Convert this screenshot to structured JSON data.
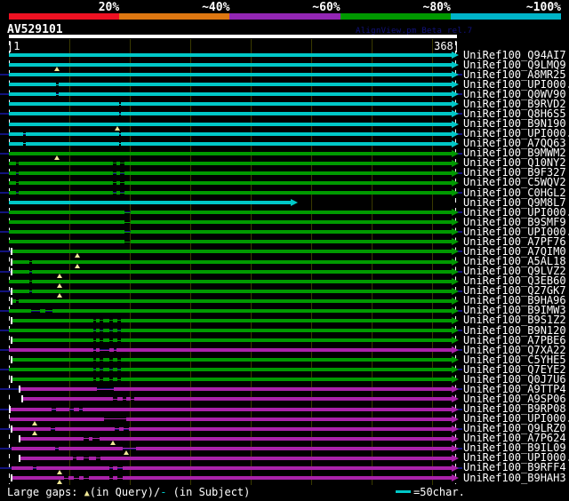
{
  "header": {
    "title": "AV529101",
    "watermark": "AlignView.pm Beta rel.7"
  },
  "scale": {
    "labels": [
      "20%",
      "~40%",
      "~60%",
      "~80%",
      "~100%"
    ],
    "colors": [
      "#EE1122",
      "#DD7711",
      "#9326B4",
      "#009900",
      "#00B4C8"
    ]
  },
  "ruler": {
    "start_label": "|1",
    "end_label": "368|",
    "length": 368
  },
  "legend": {
    "prefix": "Large gaps: ",
    "triangle": "▲",
    "mid": "(in Query)/",
    "dash": "-",
    "suffix": " (in Subject)",
    "scale_note": "=50char."
  },
  "colors": {
    "cyan": "#00C8C8",
    "green": "#009900",
    "magenta": "#AA22AA",
    "navy": "#12127E",
    "grid": "#3A3A00",
    "triangle": "#F0E896",
    "white": "#FFFFFF"
  },
  "rows": [
    {
      "label": "UniRef100_Q94AI7",
      "color": "cyan",
      "segments": [
        [
          0,
          368
        ]
      ],
      "triangles": [],
      "tick": false,
      "leader": false,
      "end": 368
    },
    {
      "label": "UniRef100_Q9LMQ9",
      "color": "cyan",
      "segments": [
        [
          0,
          368
        ]
      ],
      "triangles": [
        40
      ],
      "tick": false,
      "leader": false,
      "end": 368
    },
    {
      "label": "UniRef100_A8MR25",
      "color": "cyan",
      "segments": [
        [
          0,
          368
        ]
      ],
      "triangles": [],
      "tick": false,
      "leader": true,
      "end": 368
    },
    {
      "label": "UniRef100_UPI000..",
      "color": "cyan",
      "segments": [
        [
          0,
          39
        ],
        [
          41,
          368
        ]
      ],
      "triangles": [],
      "tick": false,
      "leader": false,
      "end": 368
    },
    {
      "label": "UniRef100_Q0WV90",
      "color": "cyan",
      "segments": [
        [
          0,
          39
        ],
        [
          41,
          368
        ]
      ],
      "triangles": [],
      "tick": false,
      "leader": true,
      "end": 368
    },
    {
      "label": "UniRef100_B9RVD2",
      "color": "cyan",
      "segments": [
        [
          0,
          91
        ],
        [
          93,
          368
        ]
      ],
      "triangles": [],
      "tick": false,
      "leader": false,
      "end": 368
    },
    {
      "label": "UniRef100_Q8H6S5",
      "color": "cyan",
      "segments": [
        [
          0,
          91
        ],
        [
          93,
          368
        ]
      ],
      "triangles": [],
      "tick": false,
      "leader": true,
      "end": 368
    },
    {
      "label": "UniRef100_B9N190",
      "color": "cyan",
      "segments": [
        [
          0,
          368
        ]
      ],
      "triangles": [
        90
      ],
      "tick": false,
      "leader": false,
      "end": 368
    },
    {
      "label": "UniRef100_UPI000..",
      "color": "cyan",
      "segments": [
        [
          0,
          12
        ],
        [
          14,
          91
        ],
        [
          93,
          368
        ]
      ],
      "triangles": [],
      "tick": false,
      "leader": true,
      "end": 368
    },
    {
      "label": "UniRef100_A7QQ63",
      "color": "cyan",
      "segments": [
        [
          0,
          12
        ],
        [
          14,
          91
        ],
        [
          93,
          368
        ]
      ],
      "triangles": [],
      "tick": false,
      "leader": false,
      "end": 368
    },
    {
      "label": "UniRef100_B9MWM2",
      "color": "green",
      "segments": [
        [
          0,
          368
        ]
      ],
      "triangles": [
        40
      ],
      "tick": false,
      "leader": true,
      "end": 368
    },
    {
      "label": "UniRef100_Q10NY2",
      "color": "green",
      "segments": [
        [
          0,
          6
        ],
        [
          8,
          86
        ],
        [
          89,
          92
        ],
        [
          96,
          368
        ]
      ],
      "triangles": [],
      "tick": false,
      "leader": false,
      "end": 368
    },
    {
      "label": "UniRef100_B9F327",
      "color": "green",
      "segments": [
        [
          0,
          6
        ],
        [
          8,
          86
        ],
        [
          89,
          92
        ],
        [
          96,
          368
        ]
      ],
      "triangles": [],
      "tick": false,
      "leader": true,
      "end": 368
    },
    {
      "label": "UniRef100_C5WQV2",
      "color": "green",
      "segments": [
        [
          0,
          6
        ],
        [
          8,
          86
        ],
        [
          89,
          92
        ],
        [
          96,
          368
        ]
      ],
      "triangles": [],
      "tick": false,
      "leader": false,
      "end": 368
    },
    {
      "label": "UniRef100_C0HGL2",
      "color": "green",
      "segments": [
        [
          0,
          6
        ],
        [
          8,
          86
        ],
        [
          89,
          92
        ],
        [
          96,
          368
        ]
      ],
      "triangles": [],
      "tick": false,
      "leader": true,
      "end": 368
    },
    {
      "label": "UniRef100_Q9M8L7",
      "color": "cyan",
      "segments": [
        [
          0,
          235
        ]
      ],
      "triangles": [],
      "tick": false,
      "leader": false,
      "end": 235
    },
    {
      "label": "UniRef100_UPI000..",
      "color": "green",
      "segments": [
        [
          0,
          96
        ],
        [
          101,
          368
        ]
      ],
      "triangles": [],
      "tick": false,
      "leader": true,
      "end": 368
    },
    {
      "label": "UniRef100_B9SMF9",
      "color": "green",
      "segments": [
        [
          0,
          96
        ],
        [
          101,
          368
        ]
      ],
      "triangles": [],
      "tick": false,
      "leader": false,
      "end": 368
    },
    {
      "label": "UniRef100_UPI000..",
      "color": "green",
      "segments": [
        [
          0,
          96
        ],
        [
          101,
          368
        ]
      ],
      "triangles": [],
      "tick": false,
      "leader": true,
      "end": 368
    },
    {
      "label": "UniRef100_A7PF76",
      "color": "green",
      "segments": [
        [
          0,
          96
        ],
        [
          101,
          368
        ]
      ],
      "triangles": [],
      "tick": false,
      "leader": false,
      "end": 368
    },
    {
      "label": "UniRef100_A7QIM0",
      "color": "green",
      "segments": [
        [
          2,
          368
        ]
      ],
      "triangles": [
        57
      ],
      "tick": true,
      "leader": true,
      "end": 368
    },
    {
      "label": "UniRef100_A5AL18",
      "color": "green",
      "segments": [
        [
          2,
          17
        ],
        [
          19,
          368
        ]
      ],
      "triangles": [
        57
      ],
      "tick": true,
      "leader": false,
      "end": 368
    },
    {
      "label": "UniRef100_Q9LVZ2",
      "color": "green",
      "segments": [
        [
          2,
          17
        ],
        [
          19,
          368
        ]
      ],
      "triangles": [
        42
      ],
      "tick": true,
      "leader": true,
      "end": 368
    },
    {
      "label": "UniRef100_Q3EB60",
      "color": "green",
      "segments": [
        [
          0,
          17
        ],
        [
          19,
          368
        ]
      ],
      "triangles": [
        42
      ],
      "tick": false,
      "leader": false,
      "end": 368
    },
    {
      "label": "UniRef100_Q27GK7",
      "color": "green",
      "segments": [
        [
          2,
          17
        ],
        [
          19,
          368
        ]
      ],
      "triangles": [
        42
      ],
      "tick": true,
      "leader": true,
      "end": 368
    },
    {
      "label": "UniRef100_B9HA96",
      "color": "green",
      "segments": [
        [
          2,
          6
        ],
        [
          8,
          368
        ]
      ],
      "triangles": [],
      "tick": true,
      "leader": false,
      "end": 368
    },
    {
      "label": "UniRef100_B9IMW3",
      "color": "green",
      "segments": [
        [
          0,
          18
        ],
        [
          26,
          30
        ],
        [
          36,
          368
        ]
      ],
      "triangles": [],
      "tick": false,
      "leader": true,
      "end": 368
    },
    {
      "label": "UniRef100_B9S1Z2",
      "color": "green",
      "segments": [
        [
          2,
          70
        ],
        [
          72,
          75
        ],
        [
          78,
          83
        ],
        [
          86,
          90
        ],
        [
          93,
          368
        ]
      ],
      "triangles": [],
      "tick": true,
      "leader": false,
      "end": 368
    },
    {
      "label": "UniRef100_B9N120",
      "color": "green",
      "segments": [
        [
          0,
          70
        ],
        [
          72,
          75
        ],
        [
          78,
          83
        ],
        [
          86,
          90
        ],
        [
          93,
          368
        ]
      ],
      "triangles": [],
      "tick": false,
      "leader": true,
      "end": 368
    },
    {
      "label": "UniRef100_A7PBE6",
      "color": "green",
      "segments": [
        [
          2,
          70
        ],
        [
          72,
          75
        ],
        [
          78,
          83
        ],
        [
          86,
          90
        ],
        [
          93,
          368
        ]
      ],
      "triangles": [],
      "tick": true,
      "leader": false,
      "end": 368
    },
    {
      "label": "UniRef100_Q7XA22",
      "color": "magenta",
      "segments": [
        [
          0,
          70
        ],
        [
          72,
          75
        ],
        [
          83,
          87
        ],
        [
          89,
          368
        ]
      ],
      "triangles": [],
      "tick": false,
      "leader": true,
      "end": 368
    },
    {
      "label": "UniRef100_C5YHE5",
      "color": "green",
      "segments": [
        [
          2,
          70
        ],
        [
          72,
          75
        ],
        [
          78,
          83
        ],
        [
          86,
          90
        ],
        [
          93,
          368
        ]
      ],
      "triangles": [],
      "tick": true,
      "leader": false,
      "end": 368
    },
    {
      "label": "UniRef100_Q7EYE2",
      "color": "green",
      "segments": [
        [
          0,
          70
        ],
        [
          72,
          75
        ],
        [
          78,
          83
        ],
        [
          86,
          90
        ],
        [
          93,
          368
        ]
      ],
      "triangles": [],
      "tick": false,
      "leader": true,
      "end": 368
    },
    {
      "label": "UniRef100_Q0J7U6",
      "color": "green",
      "segments": [
        [
          2,
          70
        ],
        [
          72,
          75
        ],
        [
          78,
          83
        ],
        [
          86,
          90
        ],
        [
          93,
          368
        ]
      ],
      "triangles": [],
      "tick": true,
      "leader": false,
      "end": 368
    },
    {
      "label": "UniRef100_A9TTP4",
      "color": "magenta",
      "segments": [
        [
          9,
          73
        ],
        [
          87,
          368
        ]
      ],
      "triangles": [],
      "tick": true,
      "leader": true,
      "end": 368
    },
    {
      "label": "UniRef100_A9SP06",
      "color": "magenta",
      "segments": [
        [
          11,
          86
        ],
        [
          90,
          94
        ],
        [
          97,
          101
        ],
        [
          104,
          368
        ]
      ],
      "triangles": [],
      "tick": true,
      "leader": false,
      "end": 368
    },
    {
      "label": "UniRef100_B9RP08",
      "color": "magenta",
      "segments": [
        [
          1,
          35
        ],
        [
          39,
          50
        ],
        [
          54,
          58
        ],
        [
          61,
          368
        ]
      ],
      "triangles": [],
      "tick": true,
      "leader": true,
      "end": 368
    },
    {
      "label": "UniRef100_UPI000..",
      "color": "magenta",
      "segments": [
        [
          1,
          79
        ],
        [
          97,
          368
        ]
      ],
      "triangles": [
        21
      ],
      "tick": false,
      "leader": false,
      "end": 368
    },
    {
      "label": "UniRef100_Q9LRZ0",
      "color": "magenta",
      "segments": [
        [
          2,
          35
        ],
        [
          38,
          88
        ],
        [
          91,
          95
        ],
        [
          99,
          368
        ]
      ],
      "triangles": [
        21
      ],
      "tick": true,
      "leader": true,
      "end": 368
    },
    {
      "label": "UniRef100_A7P624",
      "color": "magenta",
      "segments": [
        [
          9,
          62
        ],
        [
          66,
          69
        ],
        [
          75,
          368
        ]
      ],
      "triangles": [
        86
      ],
      "tick": true,
      "leader": false,
      "end": 368
    },
    {
      "label": "UniRef100_B9IL09",
      "color": "magenta",
      "segments": [
        [
          2,
          38
        ],
        [
          41,
          94
        ],
        [
          105,
          368
        ]
      ],
      "triangles": [
        97
      ],
      "tick": false,
      "leader": true,
      "end": 368
    },
    {
      "label": "UniRef100_UPI000..",
      "color": "magenta",
      "segments": [
        [
          9,
          53
        ],
        [
          56,
          62
        ],
        [
          66,
          72
        ],
        [
          76,
          368
        ]
      ],
      "triangles": [],
      "tick": true,
      "leader": false,
      "end": 368
    },
    {
      "label": "UniRef100_B9RFF4",
      "color": "magenta",
      "segments": [
        [
          2,
          20
        ],
        [
          23,
          83
        ],
        [
          86,
          90
        ],
        [
          94,
          368
        ]
      ],
      "triangles": [
        42
      ],
      "tick": false,
      "leader": true,
      "end": 368
    },
    {
      "label": "UniRef100_B9HAH3",
      "color": "magenta",
      "segments": [
        [
          2,
          46
        ],
        [
          49,
          54
        ],
        [
          58,
          62
        ],
        [
          66,
          83
        ],
        [
          86,
          90
        ],
        [
          94,
          368
        ]
      ],
      "triangles": [
        42
      ],
      "tick": true,
      "leader": false,
      "end": 368
    }
  ]
}
